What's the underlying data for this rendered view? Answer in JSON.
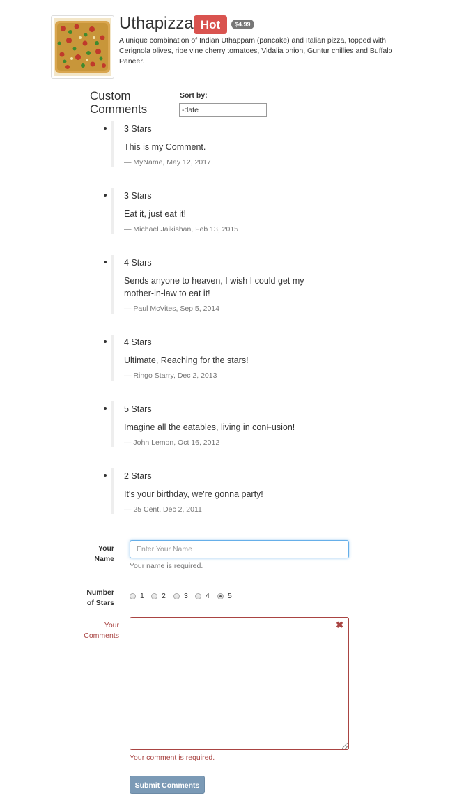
{
  "dish": {
    "name": "Uthapizza",
    "label": "Hot",
    "price": "$4.99",
    "description": "A unique combination of Indian Uthappam (pancake) and Italian pizza, topped with Cerignola olives, ripe vine cherry tomatoes, Vidalia onion, Guntur chillies and Buffalo Paneer.",
    "image_icon": "pizza-image"
  },
  "comments_section": {
    "title_line1": "Custom",
    "title_line2": "Comments",
    "sort_label": "Sort by:",
    "sort_value": "-date"
  },
  "comments": [
    {
      "rating": "3 Stars",
      "text": "This is my Comment.",
      "footer": "— MyName, May 12, 2017"
    },
    {
      "rating": "3 Stars",
      "text": "Eat it, just eat it!",
      "footer": "— Michael Jaikishan, Feb 13, 2015"
    },
    {
      "rating": "4 Stars",
      "text": "Sends anyone to heaven, I wish I could get my mother-in-law to eat it!",
      "footer": "— Paul McVites, Sep 5, 2014"
    },
    {
      "rating": "4 Stars",
      "text": "Ultimate, Reaching for the stars!",
      "footer": "— Ringo Starry, Dec 2, 2013"
    },
    {
      "rating": "5 Stars",
      "text": "Imagine all the eatables, living in conFusion!",
      "footer": "— John Lemon, Oct 16, 2012"
    },
    {
      "rating": "2 Stars",
      "text": "It's your birthday, we're gonna party!",
      "footer": "— 25 Cent, Dec 2, 2011"
    }
  ],
  "form": {
    "name_label_line1": "Your",
    "name_label_line2": "Name",
    "name_placeholder": "Enter Your Name",
    "name_value": "",
    "name_help": "Your name is required.",
    "stars_label_line1": "Number",
    "stars_label_line2": "of Stars",
    "star_options": [
      "1",
      "2",
      "3",
      "4",
      "5"
    ],
    "selected_star": "5",
    "comments_label_line1": "Your",
    "comments_label_line2": "Comments",
    "comments_value": "",
    "comments_help": "Your comment is required.",
    "submit_label": "Submit Comments",
    "error_color": "#a94442",
    "clear_icon": "close-icon"
  },
  "colors": {
    "hot_label": "#d9534f",
    "price_badge": "#777777",
    "focus_border": "#66afe9",
    "submit_button": "#7b9ab6"
  }
}
